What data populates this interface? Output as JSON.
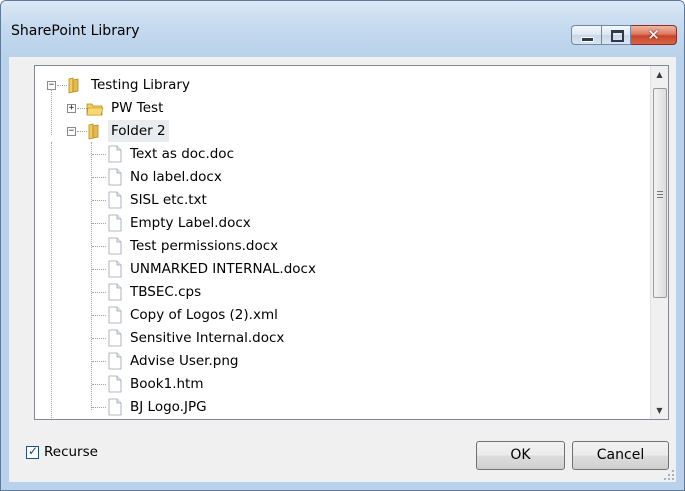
{
  "window": {
    "title": "SharePoint Library",
    "controls": {
      "minimize": "minimize",
      "maximize": "maximize",
      "close": "close"
    }
  },
  "tree": {
    "root": {
      "label": "Testing Library",
      "expanded": true,
      "icon": "folder-icon"
    },
    "children": [
      {
        "label": "PW Test",
        "expanded": false,
        "icon": "folder-icon"
      },
      {
        "label": "Folder 2",
        "expanded": true,
        "icon": "folder-icon",
        "selected": true
      }
    ],
    "files": [
      "Text as doc.doc",
      "No label.docx",
      "SISL etc.txt",
      "Empty Label.docx",
      "Test permissions.docx",
      "UNMARKED INTERNAL.docx",
      "TBSEC.cps",
      "Copy of Logos (2).xml",
      "Sensitive Internal.docx",
      "Advise User.png",
      "Book1.htm",
      "BJ Logo.JPG"
    ]
  },
  "recurse": {
    "label": "Recurse",
    "checked": true
  },
  "buttons": {
    "ok": "OK",
    "cancel": "Cancel"
  },
  "colors": {
    "title_bar": "#c6daef",
    "close_button": "#c8442a",
    "folder": "#e8b84a",
    "selection": "#e8ecef"
  }
}
